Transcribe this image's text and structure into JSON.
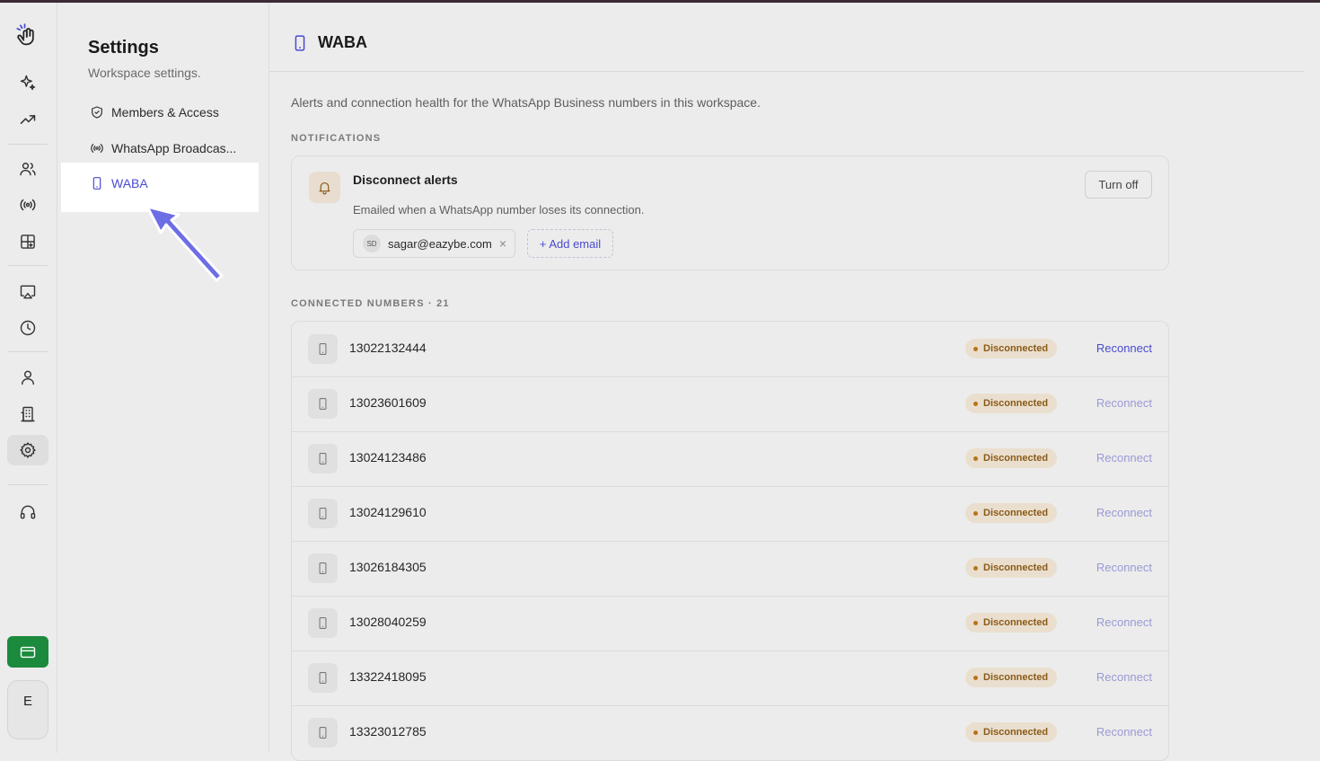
{
  "rail": {
    "icons": [
      "hand-logo-icon",
      "sparkle-icon",
      "trending-up-icon",
      "users-icon",
      "broadcast-icon",
      "apps-icon",
      "monitor-icon",
      "clock-icon",
      "user-icon",
      "building-icon",
      "settings-icon",
      "headset-icon",
      "card-icon"
    ],
    "avatar_text": "E"
  },
  "sidebar": {
    "title": "Settings",
    "subtitle": "Workspace settings.",
    "items": [
      {
        "label": "Members & Access"
      },
      {
        "label": "WhatsApp Broadcas..."
      },
      {
        "label": "WABA"
      }
    ]
  },
  "main": {
    "title": "WABA",
    "description": "Alerts and connection health for the WhatsApp Business numbers in this workspace.",
    "notifications": {
      "section_label": "NOTIFICATIONS",
      "title": "Disconnect alerts",
      "description": "Emailed when a WhatsApp number loses its connection.",
      "turn_off_label": "Turn off",
      "email_chip": {
        "initials": "SD",
        "email": "sagar@eazybe.com",
        "remove": "×"
      },
      "add_email_label": "+ Add email"
    },
    "connected": {
      "section_label": "CONNECTED NUMBERS · 21",
      "rows": [
        {
          "number": "13022132444",
          "status": "Disconnected",
          "action": "Reconnect"
        },
        {
          "number": "13023601609",
          "status": "Disconnected",
          "action": "Reconnect"
        },
        {
          "number": "13024123486",
          "status": "Disconnected",
          "action": "Reconnect"
        },
        {
          "number": "13024129610",
          "status": "Disconnected",
          "action": "Reconnect"
        },
        {
          "number": "13026184305",
          "status": "Disconnected",
          "action": "Reconnect"
        },
        {
          "number": "13028040259",
          "status": "Disconnected",
          "action": "Reconnect"
        },
        {
          "number": "13322418095",
          "status": "Disconnected",
          "action": "Reconnect"
        },
        {
          "number": "13323012785",
          "status": "Disconnected",
          "action": "Reconnect"
        }
      ]
    }
  },
  "colors": {
    "accent": "#4a4bd0",
    "status_bg": "#eadfce",
    "status_text": "#8a5a18",
    "billing": "#1b8a3d"
  }
}
